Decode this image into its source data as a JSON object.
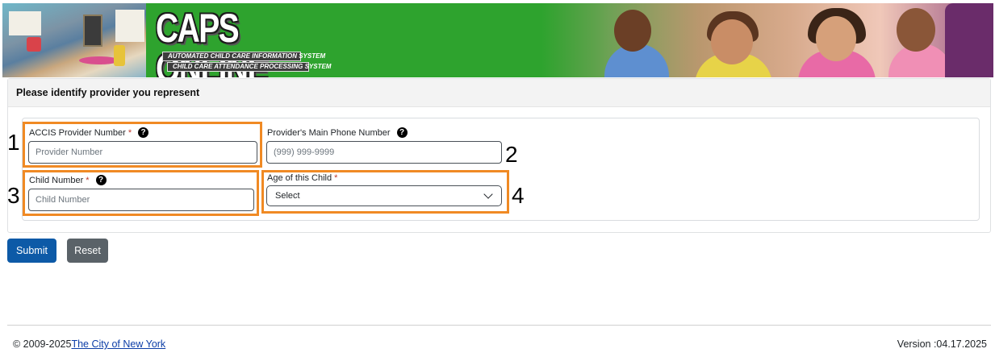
{
  "banner": {
    "title": "CAPS ONLINE",
    "subtitle1": "AUTOMATED CHILD CARE INFORMATION SYSTEM",
    "subtitle2": "CHILD CARE ATTENDANCE PROCESSING SYSTEM"
  },
  "form": {
    "header": "Please identify provider you represent",
    "fields": {
      "provider_number": {
        "label": "ACCIS Provider Number",
        "required": "*",
        "placeholder": "Provider Number",
        "help": "?"
      },
      "phone": {
        "label": "Provider's Main Phone Number",
        "placeholder": "(999) 999-9999",
        "help": "?"
      },
      "child_number": {
        "label": "Child Number",
        "required": "*",
        "placeholder": "Child Number",
        "help": "?"
      },
      "child_age": {
        "label": "Age of this Child",
        "required": "*",
        "selected": "Select"
      }
    },
    "annotations": [
      "1",
      "2",
      "3",
      "4"
    ]
  },
  "buttons": {
    "submit": "Submit",
    "reset": "Reset"
  },
  "footer": {
    "copyright": "© 2009-2025",
    "link": "The City of New York",
    "version": "Version :04.17.2025"
  },
  "colors": {
    "highlight": "#f08a24",
    "submit": "#0d5aa7",
    "reset": "#5a6268",
    "banner_green": "#2ea32e"
  }
}
